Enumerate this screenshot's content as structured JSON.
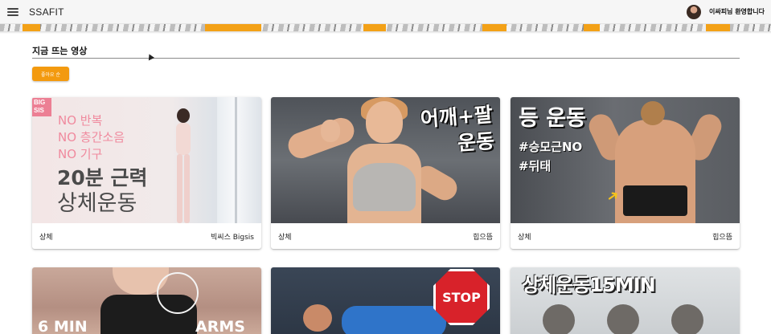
{
  "appbar": {
    "brand": "SSAFIT",
    "welcome": "이싸피님 환영합니다"
  },
  "section": {
    "title": "지금 뜨는 영상",
    "like_button": "좋아요 순"
  },
  "cards": [
    {
      "category": "상체",
      "channel": "빅씨스 Bigsis",
      "thumb": {
        "badge": "BIG SIS",
        "lines": [
          "NO 반복",
          "NO 층간소음",
          "NO 기구"
        ],
        "big1": "20분 근력",
        "big2": "상체운동"
      }
    },
    {
      "category": "상체",
      "channel": "힙으뜸",
      "thumb": {
        "title": "어깨+팔\n운동"
      }
    },
    {
      "category": "상체",
      "channel": "힙으뜸",
      "thumb": {
        "title": "등 운동",
        "tag1": "#승모근NO",
        "tag2": "#뒤태"
      }
    },
    {
      "thumb": {
        "left": "6 MIN",
        "right": "ARMS"
      }
    },
    {
      "thumb": {
        "stop": "STOP"
      }
    },
    {
      "thumb": {
        "title": "상체운동15MIN"
      }
    }
  ],
  "colors": {
    "accent": "#f39a0f",
    "appbar_bg": "#f6f6f6"
  }
}
